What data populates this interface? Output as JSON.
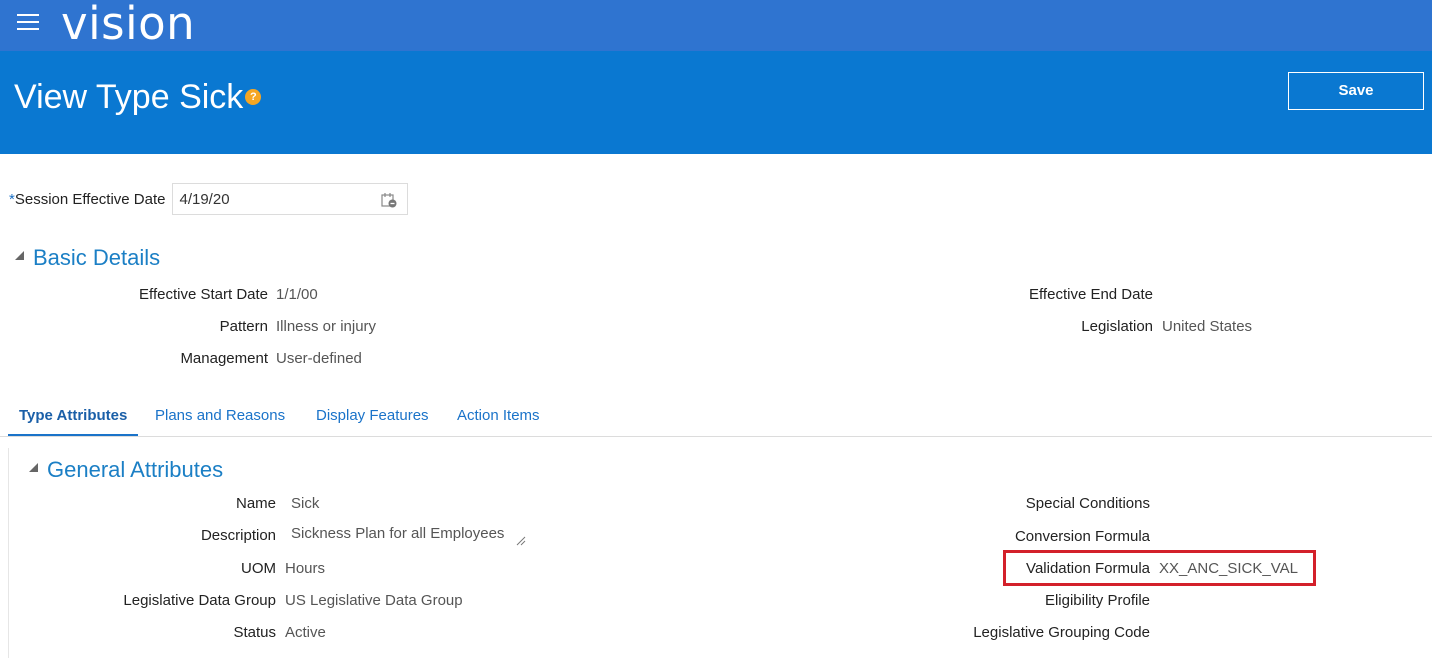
{
  "app": {
    "brand": "vision"
  },
  "header": {
    "title": "View Type Sick",
    "help": "?",
    "save_label": "Save"
  },
  "session": {
    "required_mark": "*",
    "label": "Session Effective Date",
    "value": "4/19/20"
  },
  "basic_details": {
    "title": "Basic Details",
    "left": [
      {
        "label": "Effective Start Date",
        "value": "1/1/00"
      },
      {
        "label": "Pattern",
        "value": "Illness or injury"
      },
      {
        "label": "Management",
        "value": "User-defined"
      }
    ],
    "right": [
      {
        "label": "Effective End Date",
        "value": ""
      },
      {
        "label": "Legislation",
        "value": "United States"
      }
    ]
  },
  "tabs": [
    {
      "label": "Type Attributes",
      "active": true
    },
    {
      "label": "Plans and Reasons",
      "active": false
    },
    {
      "label": "Display Features",
      "active": false
    },
    {
      "label": "Action Items",
      "active": false
    }
  ],
  "general_attributes": {
    "title": "General Attributes",
    "left": [
      {
        "label": "Name",
        "value": "Sick"
      },
      {
        "label": "Description",
        "value": "Sickness Plan for all Employees"
      },
      {
        "label": "UOM",
        "value": "Hours"
      },
      {
        "label": "Legislative Data Group",
        "value": "US Legislative Data Group"
      },
      {
        "label": "Status",
        "value": "Active"
      }
    ],
    "right": [
      {
        "label": "Special Conditions",
        "value": ""
      },
      {
        "label": "Conversion Formula",
        "value": ""
      },
      {
        "label": "Validation Formula",
        "value": "XX_ANC_SICK_VAL"
      },
      {
        "label": "Eligibility Profile",
        "value": ""
      },
      {
        "label": "Legislative Grouping Code",
        "value": ""
      }
    ]
  },
  "colors": {
    "topbar": "#2f74d0",
    "header": "#0a78d1",
    "section_title": "#1b7fc5",
    "link": "#1a73c9",
    "highlight": "#d3202a"
  },
  "icons": [
    "menu-icon",
    "help-icon",
    "calendar-icon",
    "collapse-triangle-icon"
  ]
}
